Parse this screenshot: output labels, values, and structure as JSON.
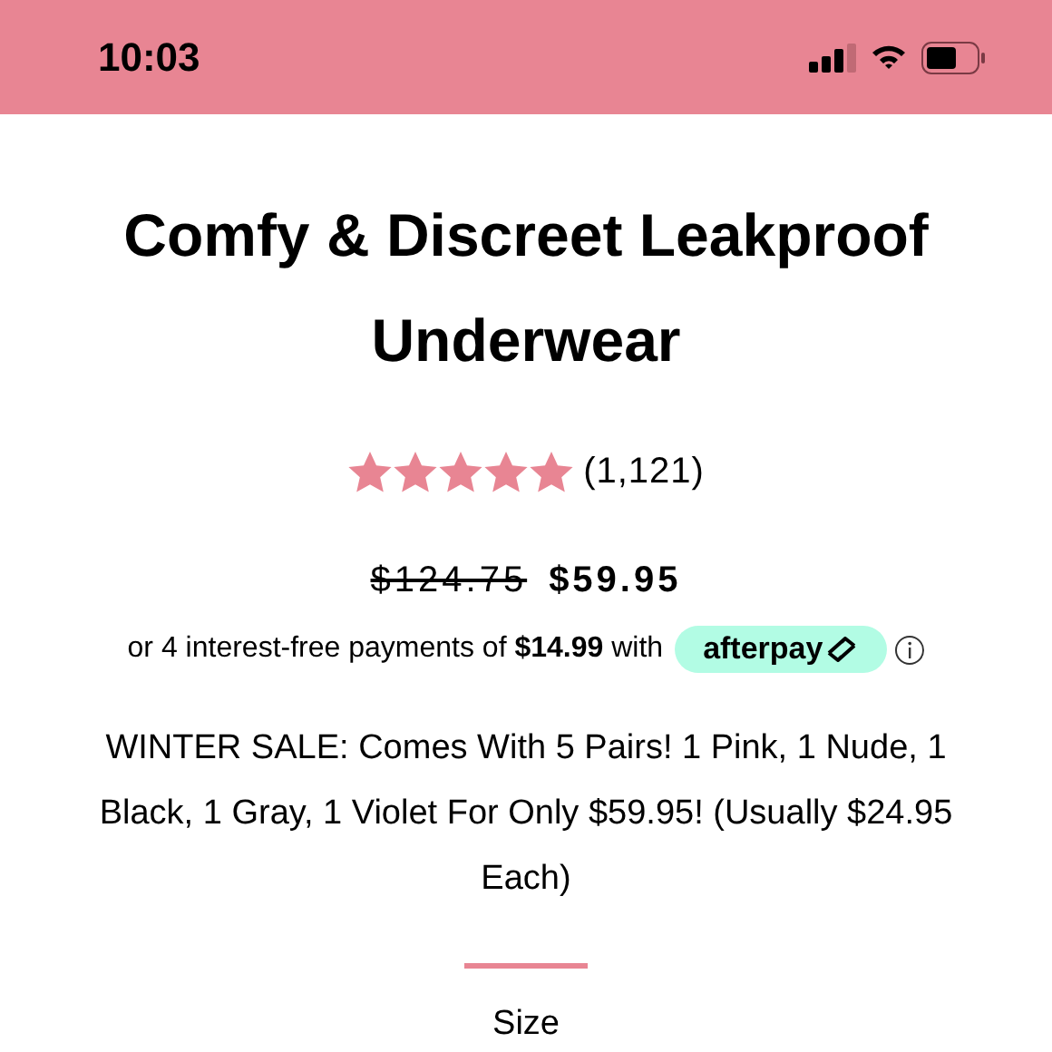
{
  "status_bar": {
    "time": "10:03"
  },
  "product": {
    "title": "Comfy & Discreet Leakproof Underwear",
    "stars": 5,
    "review_count": "(1,121)",
    "old_price": "$124.75",
    "price": "$59.95"
  },
  "installments": {
    "text": "or 4 interest-free payments of **$14.99** with",
    "provider": "afterpay"
  },
  "description": "WINTER SALE: Comes With 5 Pairs! 1 Pink, 1 Nude, 1 Black, 1 Gray, 1 Violet For Only $59.95! (Usually $24.95 Each)",
  "option_label": "Size"
}
